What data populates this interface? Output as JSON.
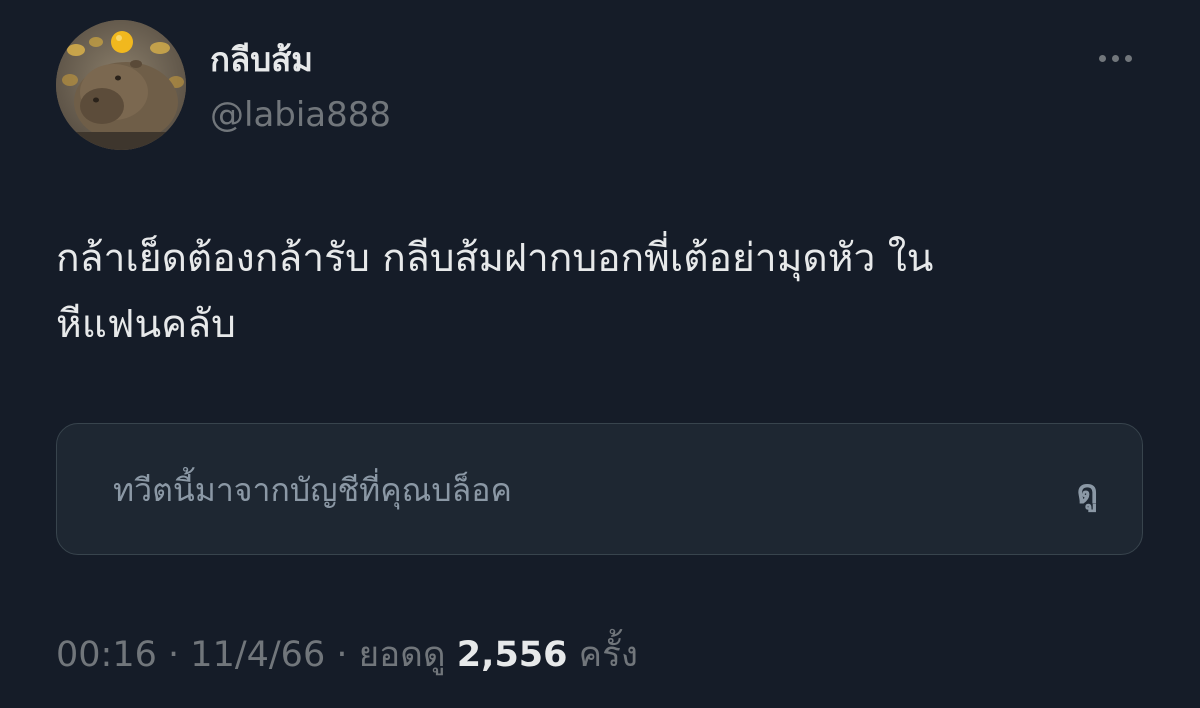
{
  "author": {
    "display_name": "กลีบส้ม",
    "handle": "@labia888"
  },
  "tweet": {
    "text_line_1": "กล้าเย็ดต้องกล้ารับ กลีบส้มฝากบอกพี่เต้อย่ามุดหัว ใน",
    "text_line_2": "หีแฟนคลับ"
  },
  "blocked_notice": {
    "message": "ทวีตนี้มาจากบัญชีที่คุณบล็อค",
    "view_label": "ดู"
  },
  "meta": {
    "time": "00:16",
    "separator": "·",
    "date": "11/4/66",
    "views_label": "ยอดดู",
    "views_count": "2,556",
    "views_unit": "ครั้ง"
  },
  "icons": {
    "more": "more-horizontal-icon",
    "avatar": "capybara-avatar"
  },
  "colors": {
    "background": "#151c28",
    "primary_text": "#e7e9ea",
    "secondary_text": "#71767b",
    "card_background": "#1e2732",
    "card_border": "#38444d"
  }
}
